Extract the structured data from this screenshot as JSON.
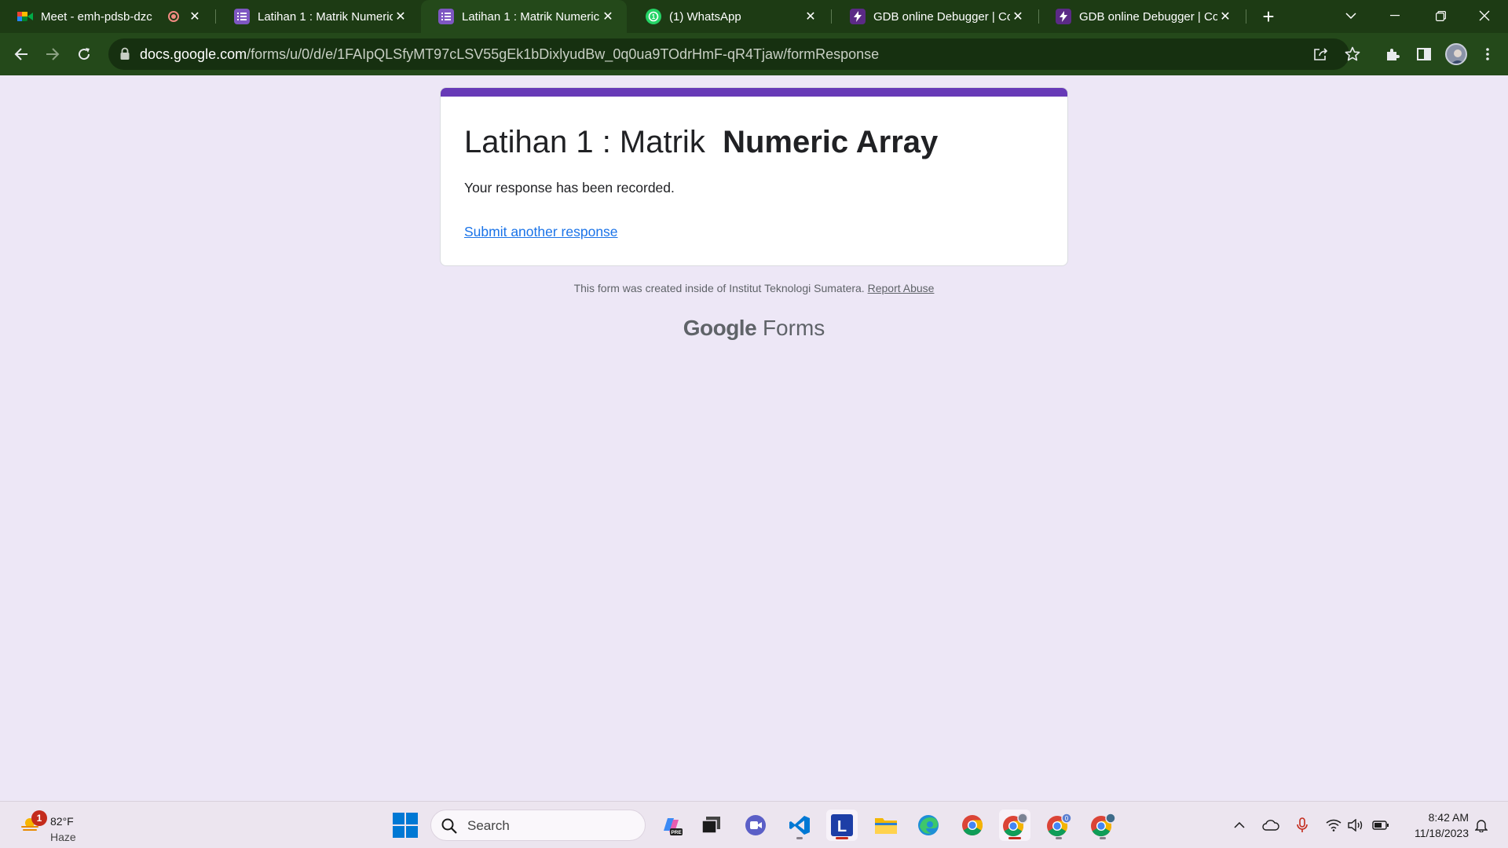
{
  "browser": {
    "tabs": [
      {
        "title": "Meet - emh-pdsb-dzc",
        "icon": "google-meet-icon",
        "recording": true,
        "active": false
      },
      {
        "title": "Latihan 1 : Matrik Numeric",
        "icon": "google-forms-icon",
        "active": false
      },
      {
        "title": "Latihan 1 : Matrik Numeric",
        "icon": "google-forms-icon",
        "active": true
      },
      {
        "title": "(1) WhatsApp",
        "icon": "whatsapp-icon",
        "active": false
      },
      {
        "title": "GDB online Debugger | Co",
        "icon": "gdb-icon",
        "active": false
      },
      {
        "title": "GDB online Debugger | Co",
        "icon": "gdb-icon",
        "active": false
      }
    ],
    "address": {
      "host": "docs.google.com",
      "path": "/forms/u/0/d/e/1FAIpQLSfyMT97cLSV55gEk1bDixlyudBw_0q0ua9TOdrHmF-qR4Tjaw/formResponse"
    },
    "colors": {
      "tabstrip": "#1d3b14",
      "toolbar": "#24491a",
      "accent": "#673ab7"
    }
  },
  "form": {
    "title_light": "Latihan 1 : Matrik",
    "title_bold": "Numeric Array",
    "confirmation": "Your response has been recorded.",
    "submit_another": "Submit another response",
    "footer_text": "This form was created inside of Institut Teknologi Sumatera.",
    "report_abuse": "Report Abuse",
    "brand_google": "Google",
    "brand_forms": "Forms"
  },
  "taskbar": {
    "weather": {
      "badge": "1",
      "temp": "82°F",
      "condition": "Haze"
    },
    "search_placeholder": "Search",
    "apps": [
      "copilot-pre-icon",
      "task-view-icon",
      "teams-meet-icon",
      "vscode-icon",
      "lms-l-icon",
      "file-explorer-icon",
      "edge-icon",
      "chrome-icon",
      "chrome-profile-1-icon",
      "chrome-profile-2-icon",
      "chrome-profile-3-icon"
    ],
    "profile_badge": "0",
    "clock": {
      "time": "8:42 AM",
      "date": "11/18/2023"
    }
  }
}
